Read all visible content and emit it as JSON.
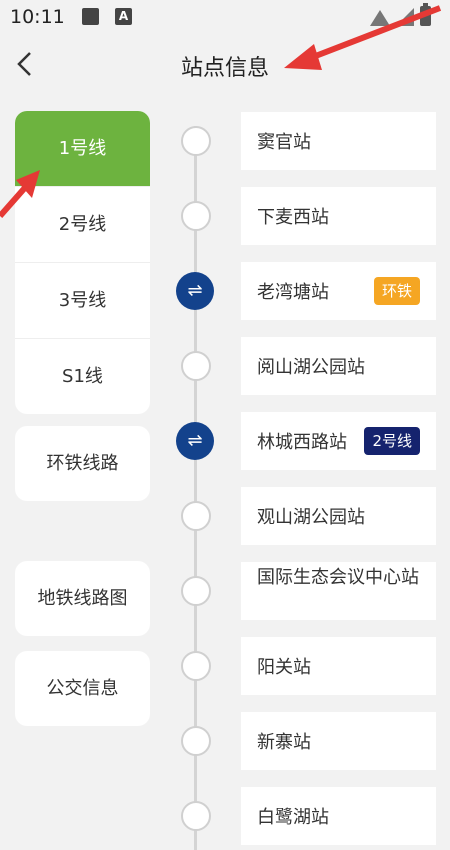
{
  "status_bar": {
    "time": "10:11",
    "icons": [
      "image-icon",
      "a-icon",
      "wifi-icon",
      "cell-icon",
      "battery-icon"
    ]
  },
  "header": {
    "title": "站点信息",
    "back_icon": "chevron-left-icon"
  },
  "sidebar": {
    "lines": [
      {
        "label": "1号线",
        "active": true
      },
      {
        "label": "2号线",
        "active": false
      },
      {
        "label": "3号线",
        "active": false
      },
      {
        "label": "S1线",
        "active": false
      }
    ],
    "extra": [
      {
        "label": "环铁线路"
      },
      {
        "label": "地铁线路图"
      },
      {
        "label": "公交信息"
      }
    ]
  },
  "stations": [
    {
      "name": "窦官站",
      "transfer": false
    },
    {
      "name": "下麦西站",
      "transfer": false
    },
    {
      "name": "老湾塘站",
      "transfer": true,
      "badge": "环铁",
      "badge_color": "#f5a623"
    },
    {
      "name": "阅山湖公园站",
      "transfer": false
    },
    {
      "name": "林城西路站",
      "transfer": true,
      "badge": "2号线",
      "badge_color": "#15236e"
    },
    {
      "name": "观山湖公园站",
      "transfer": false
    },
    {
      "name": "国际生态会议中心站",
      "transfer": false
    },
    {
      "name": "阳关站",
      "transfer": false
    },
    {
      "name": "新寨站",
      "transfer": false
    },
    {
      "name": "白鹭湖站",
      "transfer": false
    }
  ],
  "colors": {
    "active_line": "#6db33f",
    "transfer_node": "#13428c",
    "annotation_arrow": "#e53935"
  }
}
